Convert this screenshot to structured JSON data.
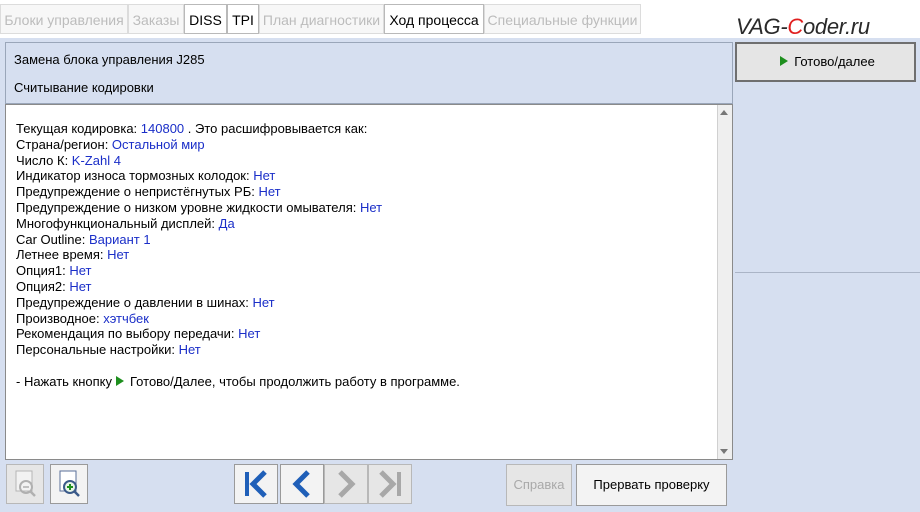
{
  "tabs": [
    {
      "label": "Блоки управления",
      "active": false
    },
    {
      "label": "Заказы",
      "active": false
    },
    {
      "label": "DISS",
      "active": true
    },
    {
      "label": "TPI",
      "active": true
    },
    {
      "label": "План диагностики",
      "active": false
    },
    {
      "label": "Ход процесса",
      "active": true
    },
    {
      "label": "Специальные функции",
      "active": false
    }
  ],
  "watermark": "VAG-Coder.ru",
  "header": {
    "title": "Замена блока управления J285",
    "subtitle": "Считывание кодировки"
  },
  "content": {
    "rows": [
      {
        "label": "Текущая кодировка: ",
        "value": "140800",
        "suffix": " . Это расшифровывается как:"
      },
      {
        "label": "Страна/регион: ",
        "value": "Остальной мир"
      },
      {
        "label": "Число К: ",
        "value": "K-Zahl 4"
      },
      {
        "label": "Индикатор износа тормозных колодок: ",
        "value": "Нет"
      },
      {
        "label": "Предупреждение о непристёгнутых РБ: ",
        "value": "Нет"
      },
      {
        "label": "Предупреждение о низком уровне жидкости омывателя: ",
        "value": "Нет"
      },
      {
        "label": "Многофункциональный дисплей: ",
        "value": "Да"
      },
      {
        "label": "Car Outline: ",
        "value": "Вариант 1"
      },
      {
        "label": "Летнее время: ",
        "value": "Нет"
      },
      {
        "label": "Опция1: ",
        "value": "Нет"
      },
      {
        "label": "Опция2: ",
        "value": "Нет"
      },
      {
        "label": "Предупреждение о давлении в шинах: ",
        "value": "Нет"
      },
      {
        "label": "Производное: ",
        "value": "хэтчбек"
      },
      {
        "label": "Рекомендация  по выбору передачи: ",
        "value": "Нет"
      },
      {
        "label": "Персональные настройки: ",
        "value": "Нет"
      }
    ],
    "instruction_prefix": "- Нажать кнопку",
    "instruction_suffix": "Готово/Далее, чтобы продолжить работу в программе."
  },
  "right_panel": {
    "next_button": "Готово/далее"
  },
  "toolbar": {
    "help_button": "Справка",
    "abort_button": "Прервать проверку"
  },
  "colors": {
    "accent_value": "#1a2ec8",
    "panel_bg": "#d6dff0",
    "play_green": "#1e8f1e"
  },
  "icons": [
    "zoom-out-icon",
    "zoom-in-icon",
    "first-icon",
    "prev-icon",
    "next-icon",
    "last-icon",
    "play-icon"
  ]
}
